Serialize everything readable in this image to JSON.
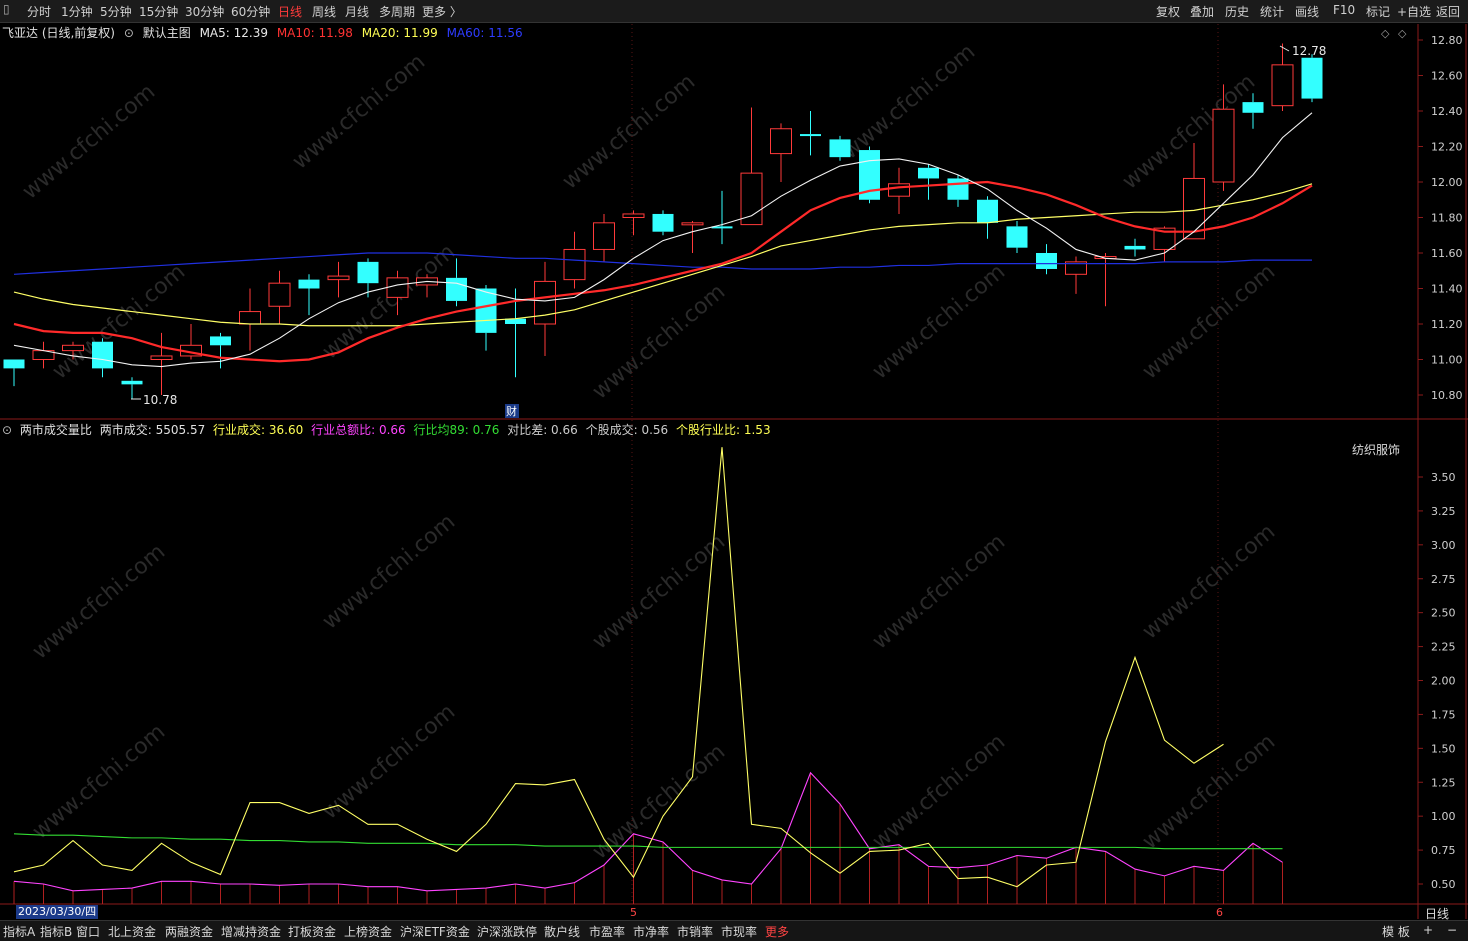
{
  "topbar": {
    "periods": [
      {
        "label": "分时",
        "active": false
      },
      {
        "label": "1分钟",
        "active": false
      },
      {
        "label": "5分钟",
        "active": false
      },
      {
        "label": "15分钟",
        "active": false
      },
      {
        "label": "30分钟",
        "active": false
      },
      {
        "label": "60分钟",
        "active": false
      },
      {
        "label": "日线",
        "active": true
      },
      {
        "label": "周线",
        "active": false
      },
      {
        "label": "月线",
        "active": false
      },
      {
        "label": "多周期",
        "active": false
      },
      {
        "label": "更多 〉",
        "active": false
      }
    ],
    "right_items": [
      "复权",
      "叠加",
      "历史",
      "统计",
      "画线",
      "F10",
      "标记",
      "+自选",
      "返回"
    ]
  },
  "main_info": {
    "stock": "飞亚达 (日线,前复权)",
    "chart_name": "默认主图",
    "ma5": "MA5: 12.39",
    "ma10": "MA10: 11.98",
    "ma20": "MA20: 11.99",
    "ma60": "MA60: 11.56"
  },
  "indicator_info": {
    "name": "两市成交量比",
    "market_vol": "两市成交: 5505.57",
    "industry_vol": "行业成交: 36.60",
    "industry_ratio": "行业总额比: 0.66",
    "industry_avg89": "行比均89: 0.76",
    "diff": "对比差: 0.66",
    "stock_vol": "个股成交: 0.56",
    "stock_industry_ratio": "个股行业比: 1.53",
    "industry_tag": "纺织服饰"
  },
  "annotations": {
    "low": "10.78",
    "high": "12.78",
    "caibao_marker": "财",
    "month5": "5",
    "month6": "6"
  },
  "bottombar": {
    "date": "2023/03/30/四",
    "tabs": [
      "指标A",
      "指标B",
      "窗口",
      "北上资金",
      "两融资金",
      "增减持资金",
      "打板资金",
      "上榜资金",
      "沪深ETF资金",
      "沪深涨跌停",
      "散户线",
      "市盈率",
      "市净率",
      "市销率",
      "市现率",
      "更多"
    ],
    "right_items": [
      "模 板",
      "+",
      "−"
    ],
    "period_btn": "日线"
  },
  "watermark": "www.cfchi.com",
  "chart_data": [
    {
      "type": "candlestick",
      "title": "飞亚达 (日线,前复权)",
      "y_ticks": [
        12.8,
        12.6,
        12.4,
        12.2,
        12.0,
        11.8,
        11.6,
        11.4,
        11.2,
        11.0,
        10.8
      ],
      "ylim": [
        10.7,
        12.85
      ],
      "candles": [
        {
          "o": 11.0,
          "c": 10.95,
          "h": 11.0,
          "l": 10.85
        },
        {
          "o": 11.0,
          "c": 11.05,
          "h": 11.1,
          "l": 10.95
        },
        {
          "o": 11.05,
          "c": 11.08,
          "h": 11.1,
          "l": 11.0
        },
        {
          "o": 11.1,
          "c": 10.95,
          "h": 11.12,
          "l": 10.9
        },
        {
          "o": 10.88,
          "c": 10.86,
          "h": 10.9,
          "l": 10.78
        },
        {
          "o": 11.0,
          "c": 11.02,
          "h": 11.15,
          "l": 10.8
        },
        {
          "o": 11.02,
          "c": 11.08,
          "h": 11.2,
          "l": 11.0
        },
        {
          "o": 11.13,
          "c": 11.08,
          "h": 11.15,
          "l": 10.95
        },
        {
          "o": 11.2,
          "c": 11.27,
          "h": 11.4,
          "l": 11.05
        },
        {
          "o": 11.3,
          "c": 11.43,
          "h": 11.5,
          "l": 11.2
        },
        {
          "o": 11.45,
          "c": 11.4,
          "h": 11.48,
          "l": 11.25
        },
        {
          "o": 11.45,
          "c": 11.47,
          "h": 11.55,
          "l": 11.35
        },
        {
          "o": 11.55,
          "c": 11.43,
          "h": 11.57,
          "l": 11.35
        },
        {
          "o": 11.35,
          "c": 11.46,
          "h": 11.5,
          "l": 11.25
        },
        {
          "o": 11.42,
          "c": 11.46,
          "h": 11.48,
          "l": 11.35
        },
        {
          "o": 11.46,
          "c": 11.33,
          "h": 11.57,
          "l": 11.3
        },
        {
          "o": 11.4,
          "c": 11.15,
          "h": 11.42,
          "l": 11.05
        },
        {
          "o": 11.23,
          "c": 11.2,
          "h": 11.4,
          "l": 10.9
        },
        {
          "o": 11.2,
          "c": 11.44,
          "h": 11.55,
          "l": 11.02
        },
        {
          "o": 11.45,
          "c": 11.62,
          "h": 11.72,
          "l": 11.4
        },
        {
          "o": 11.62,
          "c": 11.77,
          "h": 11.82,
          "l": 11.55
        },
        {
          "o": 11.8,
          "c": 11.82,
          "h": 11.84,
          "l": 11.7
        },
        {
          "o": 11.82,
          "c": 11.72,
          "h": 11.84,
          "l": 11.7
        },
        {
          "o": 11.76,
          "c": 11.77,
          "h": 11.78,
          "l": 11.6
        },
        {
          "o": 11.75,
          "c": 11.74,
          "h": 11.95,
          "l": 11.65
        },
        {
          "o": 11.76,
          "c": 12.05,
          "h": 12.42,
          "l": 11.76
        },
        {
          "o": 12.16,
          "c": 12.3,
          "h": 12.33,
          "l": 12.0
        },
        {
          "o": 12.27,
          "c": 12.26,
          "h": 12.4,
          "l": 12.15
        },
        {
          "o": 12.24,
          "c": 12.14,
          "h": 12.26,
          "l": 12.12
        },
        {
          "o": 12.18,
          "c": 11.9,
          "h": 12.2,
          "l": 11.88
        },
        {
          "o": 11.92,
          "c": 11.99,
          "h": 12.08,
          "l": 11.82
        },
        {
          "o": 12.08,
          "c": 12.02,
          "h": 12.1,
          "l": 11.9
        },
        {
          "o": 12.02,
          "c": 11.9,
          "h": 12.04,
          "l": 11.86
        },
        {
          "o": 11.9,
          "c": 11.77,
          "h": 11.92,
          "l": 11.68
        },
        {
          "o": 11.75,
          "c": 11.63,
          "h": 11.78,
          "l": 11.6
        },
        {
          "o": 11.6,
          "c": 11.51,
          "h": 11.65,
          "l": 11.48
        },
        {
          "o": 11.48,
          "c": 11.55,
          "h": 11.58,
          "l": 11.37
        },
        {
          "o": 11.58,
          "c": 11.58,
          "h": 11.6,
          "l": 11.3
        },
        {
          "o": 11.64,
          "c": 11.62,
          "h": 11.68,
          "l": 11.58
        },
        {
          "o": 11.62,
          "c": 11.74,
          "h": 11.75,
          "l": 11.55
        },
        {
          "o": 11.68,
          "c": 12.02,
          "h": 12.22,
          "l": 11.68
        },
        {
          "o": 12.0,
          "c": 12.41,
          "h": 12.55,
          "l": 11.95
        },
        {
          "o": 12.45,
          "c": 12.39,
          "h": 12.5,
          "l": 12.3
        },
        {
          "o": 12.43,
          "c": 12.66,
          "h": 12.78,
          "l": 12.4
        },
        {
          "o": 12.7,
          "c": 12.47,
          "h": 12.72,
          "l": 12.45
        }
      ],
      "ma5": [
        11.08,
        11.05,
        11.02,
        11.0,
        10.97,
        10.96,
        10.98,
        10.99,
        11.03,
        11.12,
        11.23,
        11.32,
        11.38,
        11.42,
        11.44,
        11.43,
        11.38,
        11.34,
        11.33,
        11.35,
        11.45,
        11.57,
        11.67,
        11.72,
        11.76,
        11.81,
        11.92,
        12.01,
        12.09,
        12.12,
        12.13,
        12.1,
        12.04,
        11.96,
        11.84,
        11.74,
        11.62,
        11.57,
        11.56,
        11.6,
        11.72,
        11.88,
        12.04,
        12.25,
        12.39
      ],
      "ma10": [
        11.2,
        11.16,
        11.15,
        11.15,
        11.12,
        11.07,
        11.04,
        11.01,
        11.0,
        10.99,
        11.0,
        11.04,
        11.12,
        11.18,
        11.23,
        11.27,
        11.3,
        11.33,
        11.35,
        11.37,
        11.39,
        11.42,
        11.46,
        11.5,
        11.54,
        11.6,
        11.72,
        11.84,
        11.91,
        11.95,
        11.97,
        11.98,
        11.99,
        12.0,
        11.97,
        11.93,
        11.87,
        11.8,
        11.75,
        11.72,
        11.72,
        11.75,
        11.8,
        11.88,
        11.98
      ],
      "ma20": [
        11.38,
        11.34,
        11.31,
        11.29,
        11.27,
        11.25,
        11.23,
        11.21,
        11.2,
        11.2,
        11.19,
        11.19,
        11.19,
        11.19,
        11.2,
        11.21,
        11.22,
        11.23,
        11.25,
        11.28,
        11.33,
        11.38,
        11.43,
        11.48,
        11.53,
        11.58,
        11.64,
        11.67,
        11.7,
        11.73,
        11.75,
        11.76,
        11.77,
        11.77,
        11.79,
        11.8,
        11.81,
        11.82,
        11.83,
        11.83,
        11.84,
        11.87,
        11.9,
        11.94,
        11.99
      ],
      "ma60": [
        11.48,
        11.49,
        11.5,
        11.51,
        11.52,
        11.53,
        11.54,
        11.55,
        11.56,
        11.57,
        11.58,
        11.59,
        11.6,
        11.6,
        11.6,
        11.59,
        11.58,
        11.57,
        11.57,
        11.56,
        11.55,
        11.54,
        11.53,
        11.52,
        11.52,
        11.51,
        11.51,
        11.51,
        11.52,
        11.52,
        11.53,
        11.53,
        11.54,
        11.54,
        11.54,
        11.54,
        11.54,
        11.54,
        11.54,
        11.55,
        11.55,
        11.55,
        11.56,
        11.56,
        11.56
      ]
    },
    {
      "type": "line",
      "title": "两市成交量比",
      "y_ticks": [
        3.5,
        3.25,
        3.0,
        2.75,
        2.5,
        2.25,
        2.0,
        1.75,
        1.5,
        1.25,
        1.0,
        0.75,
        0.5
      ],
      "ylim": [
        0.4,
        3.78
      ],
      "series": [
        {
          "name": "个股行业比",
          "color": "#ffff66",
          "values": [
            0.59,
            0.64,
            0.82,
            0.64,
            0.6,
            0.8,
            0.66,
            0.57,
            1.1,
            1.1,
            1.02,
            1.08,
            0.94,
            0.94,
            0.83,
            0.74,
            0.94,
            1.24,
            1.23,
            1.27,
            0.83,
            0.55,
            1.0,
            1.29,
            3.72,
            0.94,
            0.91,
            0.73,
            0.58,
            0.74,
            0.75,
            0.8,
            0.54,
            0.55,
            0.48,
            0.64,
            0.66,
            1.55,
            2.17,
            1.56,
            1.39,
            1.53
          ]
        },
        {
          "name": "行业总额比",
          "color": "#ff44ff",
          "values": [
            0.52,
            0.5,
            0.45,
            0.46,
            0.47,
            0.52,
            0.52,
            0.5,
            0.5,
            0.49,
            0.5,
            0.5,
            0.48,
            0.48,
            0.45,
            0.46,
            0.47,
            0.5,
            0.47,
            0.51,
            0.64,
            0.87,
            0.81,
            0.6,
            0.53,
            0.5,
            0.76,
            1.32,
            1.09,
            0.76,
            0.79,
            0.63,
            0.62,
            0.64,
            0.71,
            0.69,
            0.77,
            0.74,
            0.61,
            0.56,
            0.63,
            0.6,
            0.8,
            0.66
          ]
        },
        {
          "name": "行比均89",
          "color": "#33dd33",
          "values": [
            0.87,
            0.86,
            0.86,
            0.85,
            0.84,
            0.84,
            0.83,
            0.83,
            0.82,
            0.82,
            0.81,
            0.81,
            0.8,
            0.8,
            0.8,
            0.79,
            0.79,
            0.79,
            0.78,
            0.78,
            0.78,
            0.78,
            0.77,
            0.77,
            0.77,
            0.77,
            0.77,
            0.77,
            0.77,
            0.77,
            0.77,
            0.77,
            0.77,
            0.77,
            0.77,
            0.77,
            0.77,
            0.77,
            0.77,
            0.76,
            0.76,
            0.76,
            0.76,
            0.76
          ]
        }
      ]
    }
  ]
}
